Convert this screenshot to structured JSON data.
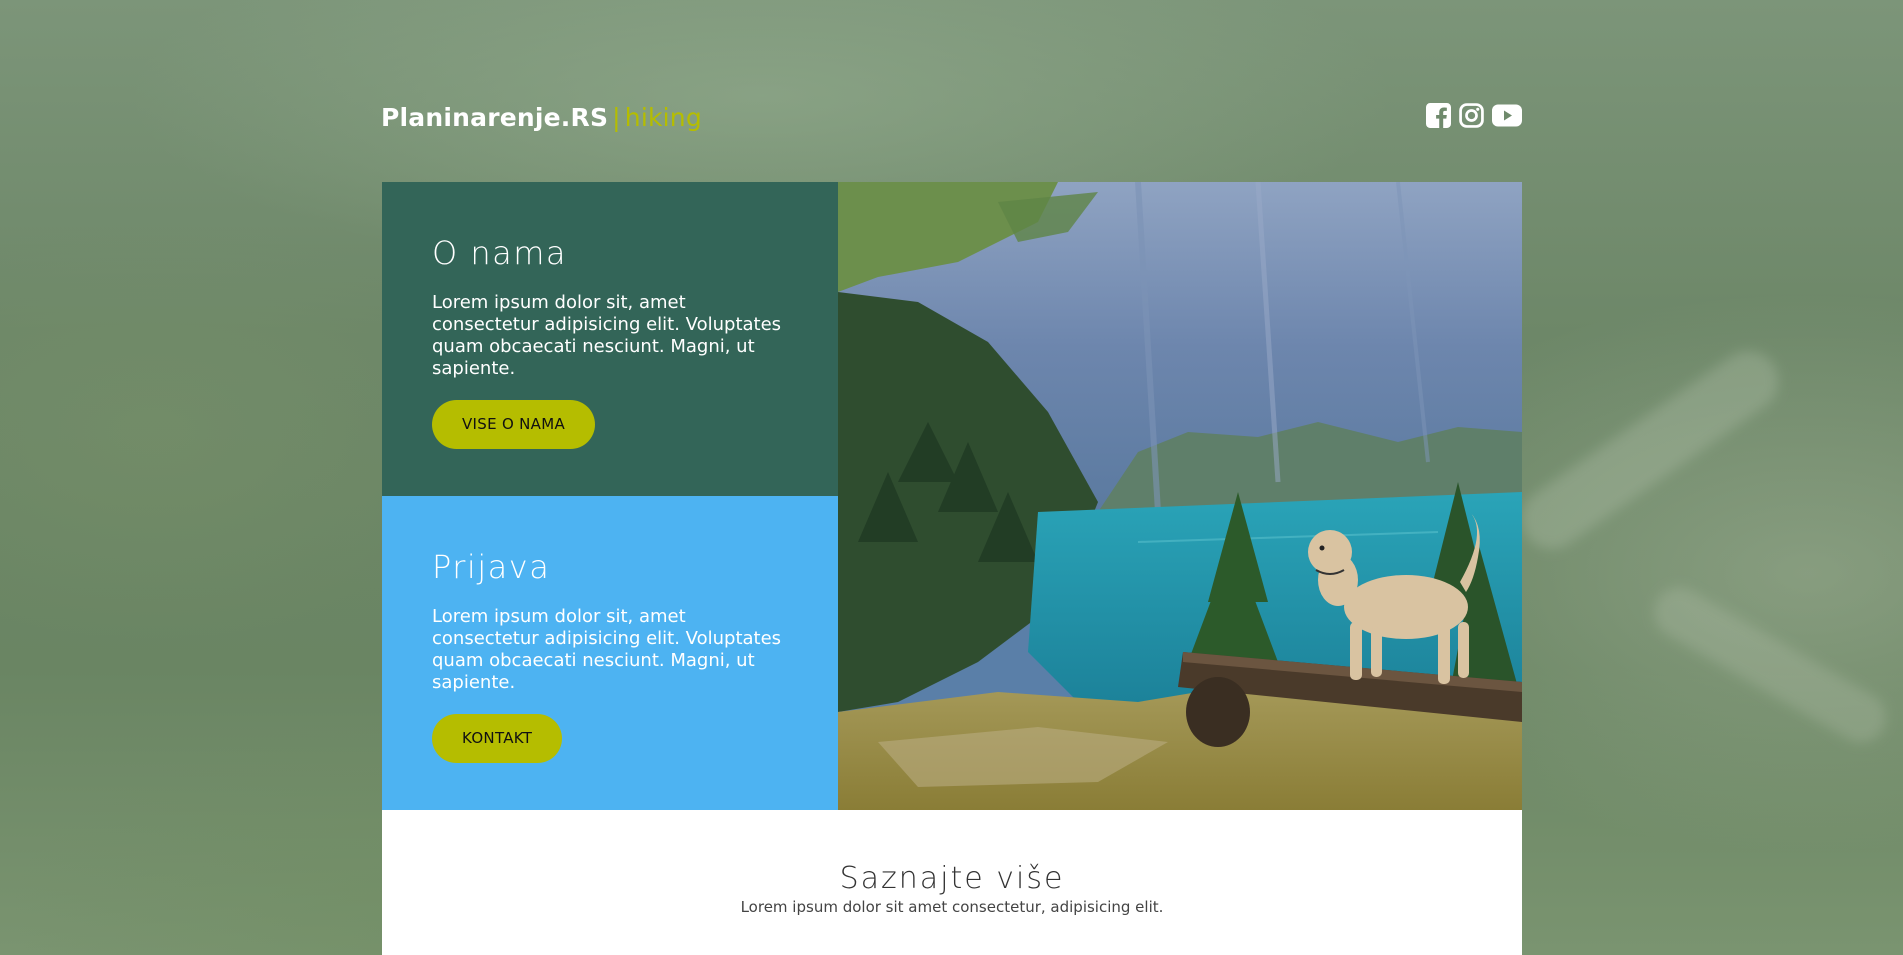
{
  "header": {
    "brand": "Planinarenje.RS",
    "separator": "|",
    "tagline": "hiking",
    "social": [
      {
        "icon": "facebook-icon"
      },
      {
        "icon": "instagram-icon"
      },
      {
        "icon": "youtube-icon"
      }
    ]
  },
  "about": {
    "title": "O nama",
    "text": "Lorem ipsum dolor sit, amet consectetur adipisicing elit. Voluptates quam obcaecati nesciunt. Magni, ut sapiente.",
    "button": "VISE O NAMA"
  },
  "signup": {
    "title": "Prijava",
    "text": "Lorem ipsum dolor sit, amet consectetur adipisicing elit. Voluptates quam obcaecati nesciunt. Magni, ut sapiente.",
    "button": "KONTAKT"
  },
  "more": {
    "title": "Saznajte više",
    "text": "Lorem ipsum dolor sit amet consectetur, adipisicing elit."
  },
  "colors": {
    "accent": "#b5bd00",
    "about_bg": "#336558",
    "signup_bg": "#4db3f2"
  }
}
